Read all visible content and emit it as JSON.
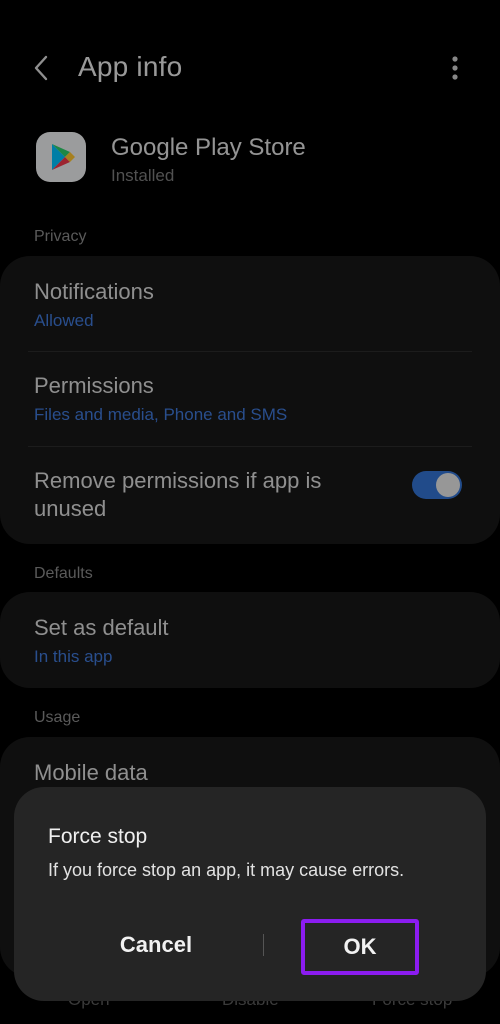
{
  "header": {
    "title": "App info",
    "back_icon": "chevron-left-icon",
    "more_icon": "more-vertical-icon"
  },
  "app": {
    "name": "Google Play Store",
    "status": "Installed",
    "icon": "google-play-icon"
  },
  "sections": {
    "privacy": {
      "label": "Privacy",
      "items": [
        {
          "title": "Notifications",
          "subtitle": "Allowed"
        },
        {
          "title": "Permissions",
          "subtitle": "Files and media, Phone and SMS"
        },
        {
          "title": "Remove permissions if app is unused",
          "toggle_on": true
        }
      ]
    },
    "defaults": {
      "label": "Defaults",
      "items": [
        {
          "title": "Set as default",
          "subtitle": "In this app"
        }
      ]
    },
    "usage": {
      "label": "Usage",
      "items": [
        {
          "title": "Mobile data"
        }
      ]
    }
  },
  "bottom_actions": [
    "Open",
    "Disable",
    "Force stop"
  ],
  "dialog": {
    "title": "Force stop",
    "message": "If you force stop an app, it may cause errors.",
    "cancel_label": "Cancel",
    "ok_label": "OK",
    "ok_highlight_color": "#8b1cf0"
  },
  "colors": {
    "accent": "#3f78d9",
    "background": "#000000",
    "card": "#171717",
    "dialog": "#252525"
  }
}
